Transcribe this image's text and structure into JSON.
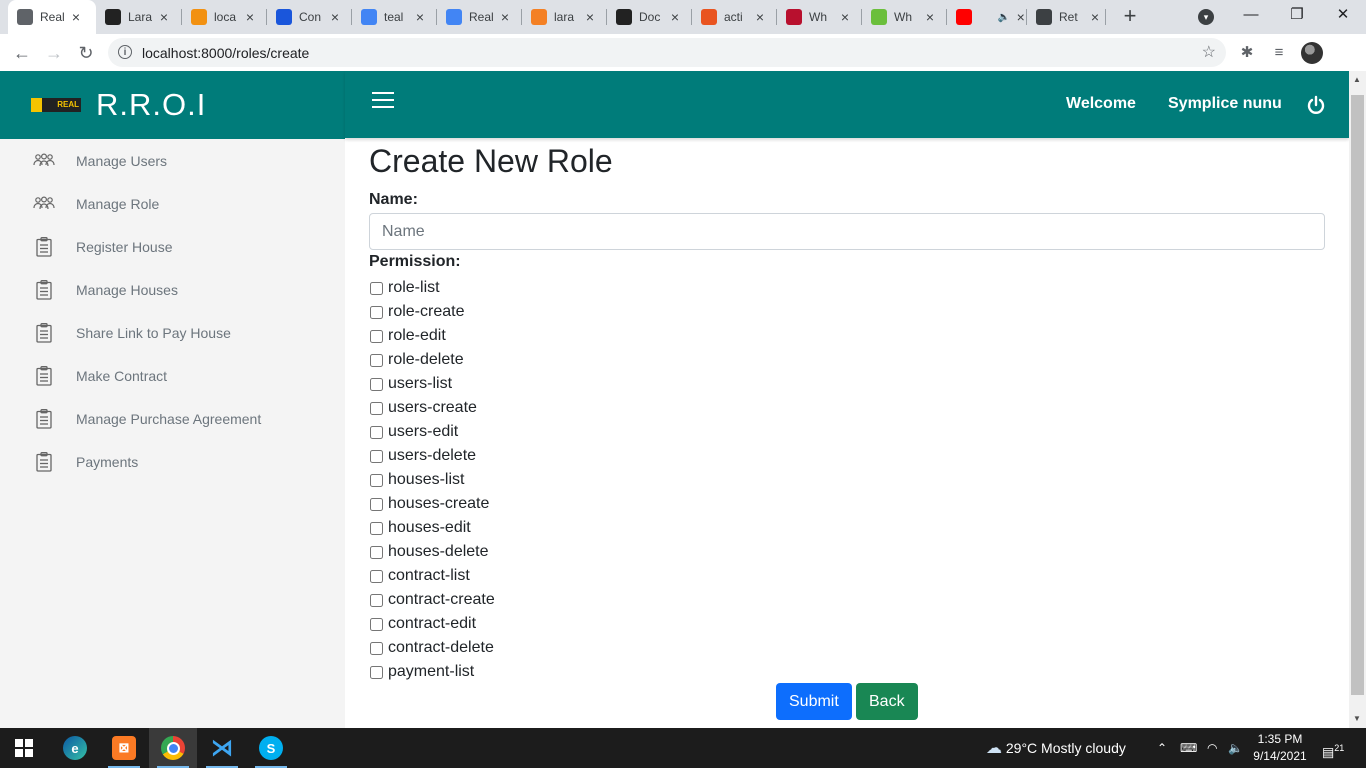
{
  "browser": {
    "tabs": [
      {
        "title": "Real",
        "favicon": "chrome-globe-icon",
        "color": "#5f6368",
        "active": true
      },
      {
        "title": "Lara",
        "favicon": "ns-icon",
        "color": "#222222"
      },
      {
        "title": "loca",
        "favicon": "phpmyadmin-icon",
        "color": "#f29111"
      },
      {
        "title": "Con",
        "favicon": "circle-c-icon",
        "color": "#1a56db"
      },
      {
        "title": "teal",
        "favicon": "google-icon",
        "color": "#4285f4"
      },
      {
        "title": "Real",
        "favicon": "docs-icon",
        "color": "#4285f4"
      },
      {
        "title": "lara",
        "favicon": "stackoverflow-icon",
        "color": "#f48024"
      },
      {
        "title": "Doc",
        "favicon": "laravel-doc-icon",
        "color": "#222222"
      },
      {
        "title": "acti",
        "favicon": "ubuntu-icon",
        "color": "#e95420"
      },
      {
        "title": "Wh",
        "favicon": "d-icon",
        "color": "#b8102e"
      },
      {
        "title": "Wh",
        "favicon": "green-ring-icon",
        "color": "#6bbf3c"
      },
      {
        "title": "",
        "favicon": "youtube-icon",
        "color": "#ff0000",
        "audio": true
      },
      {
        "title": "Ret",
        "favicon": "edge-like-icon",
        "color": "#3c4043"
      }
    ],
    "url": "localhost:8000/roles/create"
  },
  "sidebar": {
    "brand": "R.R.O.I",
    "logo_text": "REAL",
    "items": [
      {
        "label": "Manage Users",
        "icon": "users-icon"
      },
      {
        "label": "Manage Role",
        "icon": "users-icon"
      },
      {
        "label": "Register House",
        "icon": "clipboard-icon"
      },
      {
        "label": "Manage Houses",
        "icon": "clipboard-icon"
      },
      {
        "label": "Share Link to Pay House",
        "icon": "clipboard-icon"
      },
      {
        "label": "Make Contract",
        "icon": "clipboard-icon"
      },
      {
        "label": "Manage Purchase Agreement",
        "icon": "clipboard-icon"
      },
      {
        "label": "Payments",
        "icon": "clipboard-icon"
      }
    ]
  },
  "header": {
    "welcome": "Welcome",
    "username": "Symplice nunu"
  },
  "form": {
    "title": "Create New Role",
    "name_label": "Name:",
    "name_placeholder": "Name",
    "permission_label": "Permission:",
    "permissions": [
      "role-list",
      "role-create",
      "role-edit",
      "role-delete",
      "users-list",
      "users-create",
      "users-edit",
      "users-delete",
      "houses-list",
      "houses-create",
      "houses-edit",
      "houses-delete",
      "contract-list",
      "contract-create",
      "contract-edit",
      "contract-delete",
      "payment-list"
    ],
    "submit_label": "Submit",
    "back_label": "Back"
  },
  "taskbar": {
    "weather": "29°C  Mostly cloudy",
    "time": "1:35 PM",
    "date": "9/14/2021",
    "notifications": "21"
  },
  "colors": {
    "brand_teal": "#007c7a",
    "submit_blue": "#0d6efd",
    "back_green": "#198754"
  }
}
